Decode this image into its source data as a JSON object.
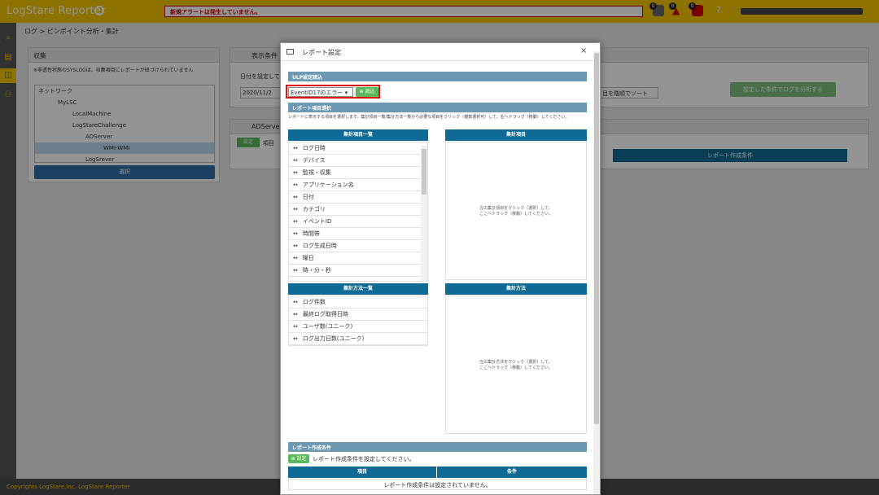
{
  "app": {
    "brand": "LogStare Reporter",
    "alert_text": "新規アラートは発生していません。",
    "badges": [
      "0",
      "0",
      "0"
    ],
    "breadcrumb": "ログ > ピンポイント分析・集計",
    "footer_text": "Copyrights LogStare,Inc.  LogStare Reporter"
  },
  "left_panel": {
    "title": "収集",
    "note": "※非透性状態のSYSLOGは、収集項目にレポートが紐づけられていません",
    "tree": [
      "ネットワーク",
      "MyLSC",
      "LocalMachine",
      "LogStareChallenge",
      "ADServer",
      "WMI-WMI",
      "LogSrever"
    ],
    "select_button": "選択"
  },
  "background": {
    "display_condition_title": "表示条件",
    "date_label": "日付を設定して",
    "date_value": "2020/11/2",
    "analyze_button": "設定した条件でログを分析する",
    "sort_select": "目を階順でソート",
    "adserver_label": "ADServer",
    "settings_button": "設定",
    "item_label": "項目",
    "report_condition_bar": "レポート作成条件"
  },
  "modal": {
    "title": "レポート設定",
    "close": "×",
    "ulp_section": "ULP設定読込",
    "load_select": "EventID17のエラー",
    "load_button": "読込",
    "item_section": "レポート項目選択",
    "description": "レポートに表示する項目を選択します。集計項目一覧/集計方法一覧から必要な項目をクリック（複数選択可）して、右へドラッグ（移動）してください。",
    "items_list_header": "集計項目一覧",
    "items_target_header": "集計項目",
    "items": [
      "ログ日時",
      "デバイス",
      "監視・収集",
      "アプリケーション名",
      "日付",
      "カテゴリ",
      "イベントID",
      "時間帯",
      "ログ生成日時",
      "曜日",
      "時・分・秒"
    ],
    "items_hint_1": "左の集計項目をクリック（選択）して、",
    "items_hint_2": "ここへドラッグ（移動）してください。",
    "methods_list_header": "集計方法一覧",
    "methods_target_header": "集計方法",
    "methods": [
      "ログ件数",
      "最終ログ取得日時",
      "ユーザ数(ユニーク)",
      "ログ出力日数(ユニーク)"
    ],
    "methods_hint_1": "左の集計方法をクリック（選択）して、",
    "methods_hint_2": "ここへドラッグ（移動）してください。",
    "condition_section": "レポート作成条件",
    "condition_button": "設定",
    "condition_text": "レポート作成条件を設定してください。",
    "table_col_item": "項目",
    "table_col_condition": "条件",
    "table_empty": "レポート作成条件は設定されていません。"
  }
}
